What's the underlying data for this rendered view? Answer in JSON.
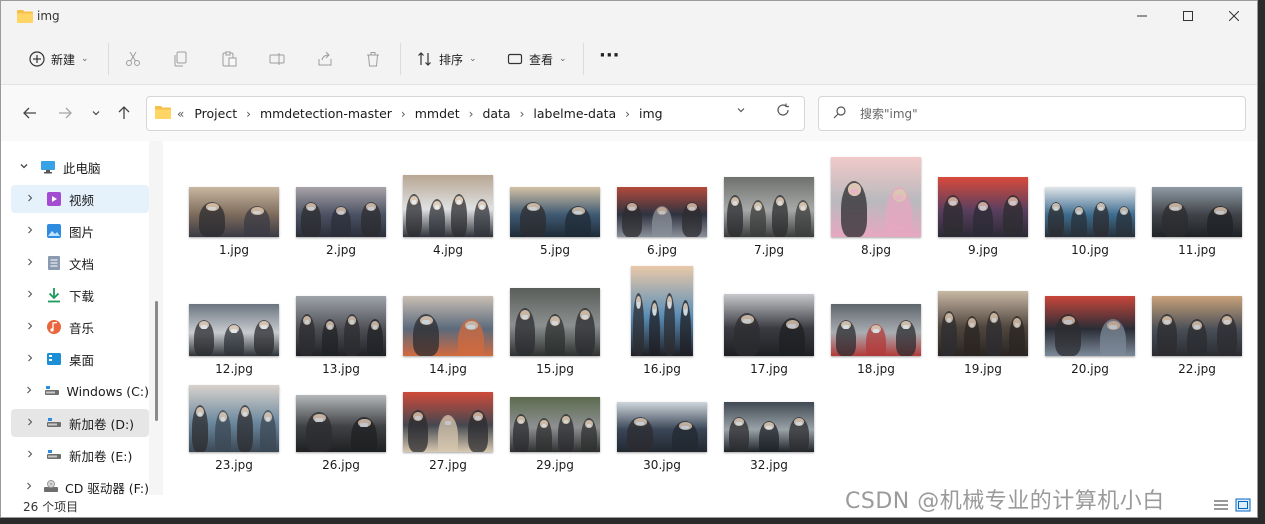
{
  "window": {
    "title": "img",
    "minimize_icon": "minimize-icon",
    "maximize_icon": "maximize-icon",
    "close_icon": "close-icon"
  },
  "toolbar": {
    "new_label": "新建",
    "sort_label": "排序",
    "view_label": "查看",
    "more_label": "···"
  },
  "breadcrumb": {
    "overflow": "«",
    "items": [
      "Project",
      "mmdetection-master",
      "mmdet",
      "data",
      "labelme-data",
      "img"
    ]
  },
  "search": {
    "placeholder": "搜索\"img\""
  },
  "sidebar": {
    "items": [
      {
        "label": "此电脑",
        "icon": "computer-icon",
        "expanded": true
      },
      {
        "label": "视频",
        "icon": "video-folder-icon",
        "active": true
      },
      {
        "label": "图片",
        "icon": "pictures-folder-icon"
      },
      {
        "label": "文档",
        "icon": "documents-folder-icon"
      },
      {
        "label": "下载",
        "icon": "downloads-folder-icon"
      },
      {
        "label": "音乐",
        "icon": "music-folder-icon"
      },
      {
        "label": "桌面",
        "icon": "desktop-folder-icon"
      },
      {
        "label": "Windows (C:)",
        "icon": "drive-icon"
      },
      {
        "label": "新加卷 (D:)",
        "icon": "drive-icon",
        "selected": true
      },
      {
        "label": "新加卷 (E:)",
        "icon": "drive-icon"
      },
      {
        "label": "CD 驱动器 (F:)",
        "icon": "cd-drive-icon"
      }
    ]
  },
  "files": [
    "1.jpg",
    "2.jpg",
    "4.jpg",
    "5.jpg",
    "6.jpg",
    "7.jpg",
    "8.jpg",
    "9.jpg",
    "10.jpg",
    "11.jpg",
    "12.jpg",
    "13.jpg",
    "14.jpg",
    "15.jpg",
    "16.jpg",
    "17.jpg",
    "18.jpg",
    "19.jpg",
    "20.jpg",
    "22.jpg",
    "23.jpg",
    "26.jpg",
    "27.jpg",
    "29.jpg",
    "30.jpg",
    "32.jpg"
  ],
  "status": {
    "count": "26 个项目"
  },
  "watermark": "CSDN @机械专业的计算机小白",
  "colors": {
    "accent": "#0067c0",
    "active_bg": "#e5f1fb",
    "selected_bg": "#e6e6e6"
  }
}
